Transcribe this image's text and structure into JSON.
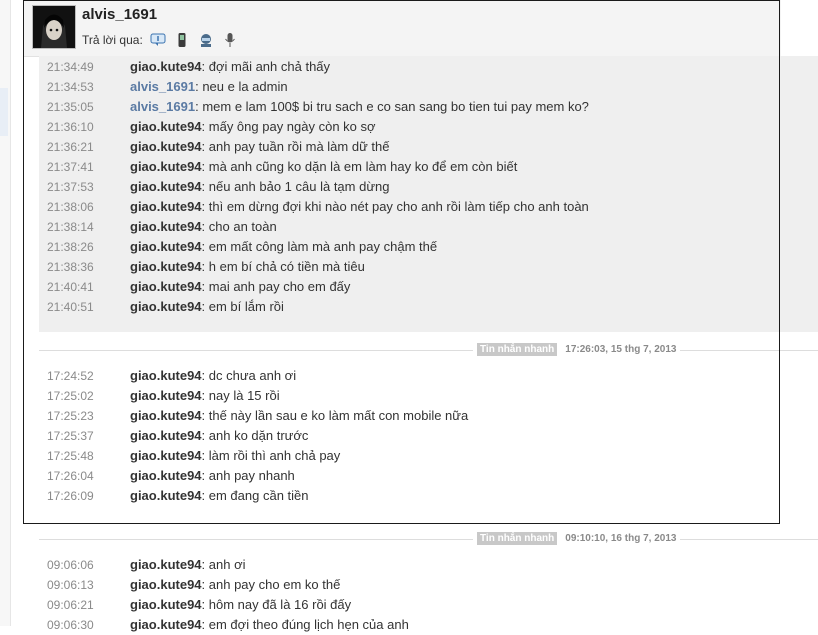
{
  "header": {
    "username": "alvis_1691",
    "reply_label": "Trả lời qua:",
    "reply_icons": [
      "message-icon",
      "mobile-icon",
      "robot-icon",
      "microphone-icon"
    ]
  },
  "block1": [
    {
      "time": "21:34:49",
      "sender": "giao.kute94",
      "text": "đợi mãi anh chả thấy"
    },
    {
      "time": "21:34:53",
      "sender": "alvis_1691",
      "text": "neu e la admin"
    },
    {
      "time": "21:35:05",
      "sender": "alvis_1691",
      "text": "mem e lam 100$ bi tru sach e co san sang bo tien tui pay mem ko?"
    },
    {
      "time": "21:36:10",
      "sender": "giao.kute94",
      "text": "mấy ông pay ngày còn ko sợ"
    },
    {
      "time": "21:36:21",
      "sender": "giao.kute94",
      "text": "anh pay tuần rồi mà làm dữ thế"
    },
    {
      "time": "21:37:41",
      "sender": "giao.kute94",
      "text": "mà anh cũng ko dặn là em làm hay ko để em còn biết"
    },
    {
      "time": "21:37:53",
      "sender": "giao.kute94",
      "text": "nếu anh bảo 1 câu là tạm dừng"
    },
    {
      "time": "21:38:06",
      "sender": "giao.kute94",
      "text": "thì em dừng đợi khi nào nét pay cho anh rồi làm tiếp cho anh toàn"
    },
    {
      "time": "21:38:14",
      "sender": "giao.kute94",
      "text": "cho an toàn"
    },
    {
      "time": "21:38:26",
      "sender": "giao.kute94",
      "text": "em mất công làm mà anh pay chậm thế"
    },
    {
      "time": "21:38:36",
      "sender": "giao.kute94",
      "text": "h em bí chả có tiền mà tiêu"
    },
    {
      "time": "21:40:41",
      "sender": "giao.kute94",
      "text": "mai anh pay cho em đấy"
    },
    {
      "time": "21:40:51",
      "sender": "giao.kute94",
      "text": "em bí lắm rồi"
    }
  ],
  "separator1": {
    "tag": "Tin nhắn nhanh",
    "datetime": "17:26:03, 15 thg 7, 2013"
  },
  "block2": [
    {
      "time": "17:24:52",
      "sender": "giao.kute94",
      "text": "dc chưa anh ơi"
    },
    {
      "time": "17:25:02",
      "sender": "giao.kute94",
      "text": "nay là 15 rồi"
    },
    {
      "time": "17:25:23",
      "sender": "giao.kute94",
      "text": "thế này lần sau e ko làm mất con mobile nữa"
    },
    {
      "time": "17:25:37",
      "sender": "giao.kute94",
      "text": "anh ko dặn trước"
    },
    {
      "time": "17:25:48",
      "sender": "giao.kute94",
      "text": "làm rồi thì anh chả pay"
    },
    {
      "time": "17:26:04",
      "sender": "giao.kute94",
      "text": "anh pay nhanh"
    },
    {
      "time": "17:26:09",
      "sender": "giao.kute94",
      "text": "em đang cần tiền"
    }
  ],
  "separator2": {
    "tag": "Tin nhắn nhanh",
    "datetime": "09:10:10, 16 thg 7, 2013"
  },
  "block3": [
    {
      "time": "09:06:06",
      "sender": "giao.kute94",
      "text": "anh ơi"
    },
    {
      "time": "09:06:13",
      "sender": "giao.kute94",
      "text": "anh pay cho em ko thế"
    },
    {
      "time": "09:06:21",
      "sender": "giao.kute94",
      "text": "hôm nay đã là 16 rồi đấy"
    },
    {
      "time": "09:06:30",
      "sender": "giao.kute94",
      "text": "em đợi theo đúng lịch hẹn của anh"
    }
  ],
  "colors": {
    "blue_sender": "#5a7aa3",
    "time": "#8a8a8a",
    "panel_gray": "#efefef"
  }
}
